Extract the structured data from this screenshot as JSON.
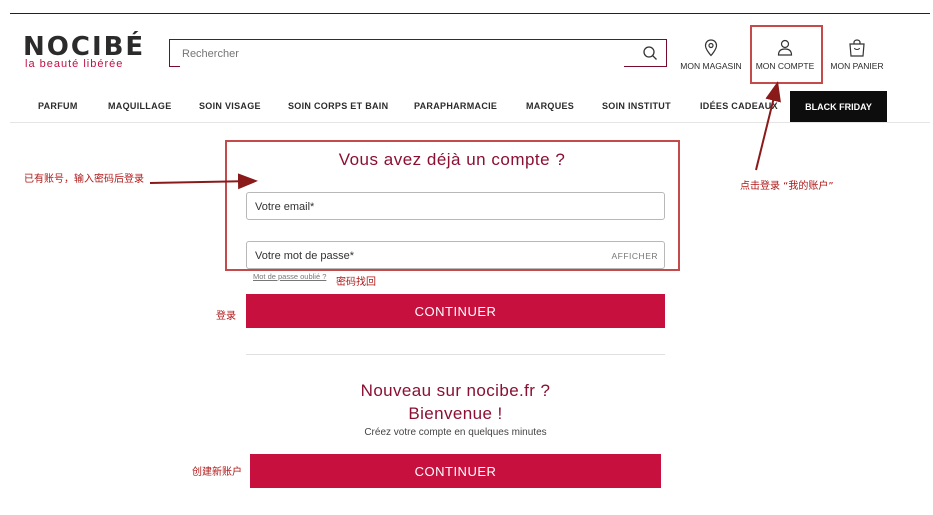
{
  "brand": {
    "logo": "NOCIBÉ",
    "tagline": "la beauté libérée",
    "accent": "#c8103f",
    "title_color": "#8a0f33"
  },
  "search": {
    "placeholder": "Rechercher",
    "icon": "search-icon"
  },
  "header_icons": [
    {
      "label": "MON MAGASIN",
      "icon": "location-pin-icon"
    },
    {
      "label": "MON COMPTE",
      "icon": "user-icon"
    },
    {
      "label": "MON PANIER",
      "icon": "shopping-bag-icon"
    }
  ],
  "nav": {
    "items": [
      "PARFUM",
      "MAQUILLAGE",
      "SOIN VISAGE",
      "SOIN CORPS ET BAIN",
      "PARAPHARMACIE",
      "MARQUES",
      "SOIN INSTITUT",
      "IDÉES CADEAUX"
    ],
    "highlight": "BLACK FRIDAY"
  },
  "login": {
    "title": "Vous avez déjà un compte ?",
    "email_placeholder": "Votre email*",
    "password_placeholder": "Votre mot de passe*",
    "show_password": "AFFICHER",
    "forgot": "Mot de passe oublié ?",
    "continue": "CONTINUER"
  },
  "register": {
    "title_line1": "Nouveau sur nocibe.fr ?",
    "title_line2": "Bienvenue !",
    "subtitle": "Créez votre compte en quelques minutes",
    "continue": "CONTINUER"
  },
  "annotations": {
    "account_login": "已有账号，输入密码后登录",
    "click_account": "点击登录 “我的账户”",
    "recover_password": "密码找回",
    "login": "登录",
    "create_account": "创建新账户",
    "color": "#b01818"
  }
}
